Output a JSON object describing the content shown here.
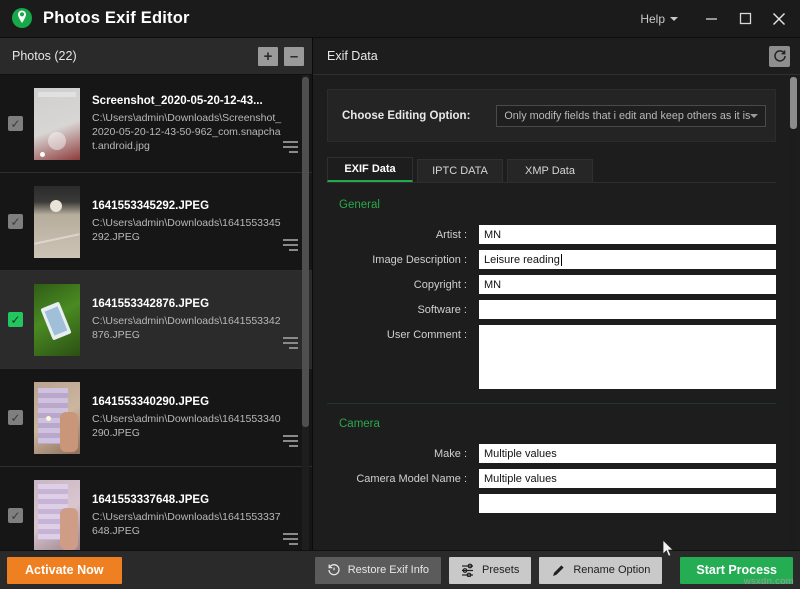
{
  "window": {
    "app_title": "Photos Exif Editor",
    "logo_icon": "green-location-pin-logo",
    "help_label": "Help",
    "minimize_icon": "minimize-icon",
    "maximize_icon": "maximize-icon",
    "close_icon": "close-icon"
  },
  "left_panel": {
    "header_title": "Photos (22)",
    "add_label": "+",
    "remove_label": "–",
    "items": [
      {
        "name": "Screenshot_2020-05-20-12-43...",
        "path": "C:\\Users\\admin\\Downloads\\Screenshot_2020-05-20-12-43-50-962_com.snapchat.android.jpg",
        "checked": true,
        "selected": false,
        "thumb": "screenshot-phone"
      },
      {
        "name": "1641553345292.JPEG",
        "path": "C:\\Users\\admin\\Downloads\\1641553345292.JPEG",
        "checked": true,
        "selected": false,
        "thumb": "pavement-cat"
      },
      {
        "name": "1641553342876.JPEG",
        "path": "C:\\Users\\admin\\Downloads\\1641553342876.JPEG",
        "checked": true,
        "selected": true,
        "thumb": "grass-phone"
      },
      {
        "name": "1641553340290.JPEG",
        "path": "C:\\Users\\admin\\Downloads\\1641553340290.JPEG",
        "checked": true,
        "selected": false,
        "thumb": "hand-lights"
      },
      {
        "name": "1641553337648.JPEG",
        "path": "C:\\Users\\admin\\Downloads\\1641553337648.JPEG",
        "checked": true,
        "selected": false,
        "thumb": "hand-lights2"
      }
    ]
  },
  "right_panel": {
    "header_title": "Exif Data",
    "refresh_icon": "refresh-icon",
    "editing_option": {
      "label": "Choose Editing Option:",
      "selected": "Only modify fields that i edit and keep others as it is",
      "caret_icon": "chevron-down-icon"
    },
    "tabs": [
      {
        "label": "EXIF Data",
        "active": true
      },
      {
        "label": "IPTC DATA",
        "active": false
      },
      {
        "label": "XMP Data",
        "active": false
      }
    ],
    "sections": [
      {
        "title": "General",
        "fields": [
          {
            "label": "Artist :",
            "value": "MN",
            "type": "input",
            "focused": false
          },
          {
            "label": "Image Description :",
            "value": "Leisure reading",
            "type": "input",
            "focused": true
          },
          {
            "label": "Copyright :",
            "value": "MN",
            "type": "input",
            "focused": false
          },
          {
            "label": "Software :",
            "value": "",
            "type": "input",
            "focused": false
          },
          {
            "label": "User Comment :",
            "value": "",
            "type": "textarea",
            "focused": false
          }
        ]
      },
      {
        "title": "Camera",
        "fields": [
          {
            "label": "Make :",
            "value": "Multiple values",
            "type": "input",
            "focused": false
          },
          {
            "label": "Camera Model Name :",
            "value": "Multiple values",
            "type": "input",
            "focused": false
          },
          {
            "label": "",
            "value": "",
            "type": "input",
            "focused": false
          }
        ]
      }
    ]
  },
  "bottom_bar": {
    "activate_label": "Activate Now",
    "restore_label": "Restore Exif Info",
    "restore_icon": "restore-clock-icon",
    "presets_label": "Presets",
    "presets_icon": "sliders-icon",
    "rename_label": "Rename Option",
    "rename_icon": "pencil-icon",
    "start_label": "Start Process"
  },
  "watermark": "wsxdn.com",
  "colors": {
    "accent_green": "#25ad54",
    "section_green": "#2aa84a",
    "activate_orange": "#ef8022",
    "window_bg": "#1b1b1b",
    "panel_bg": "#1d1d1d",
    "selected_row": "#2b2b2b"
  }
}
